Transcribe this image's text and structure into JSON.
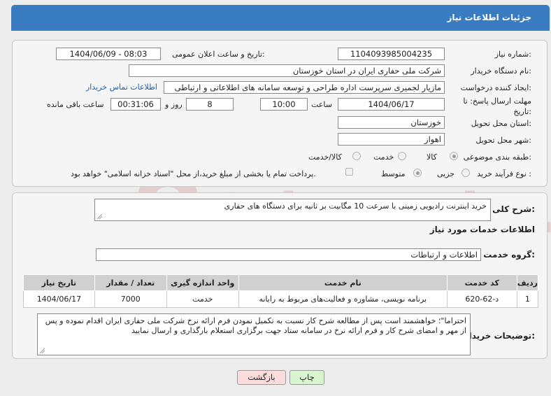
{
  "header": {
    "title": "جزئیات اطلاعات نیاز"
  },
  "form": {
    "need_number_label": "شماره نیاز:",
    "need_number": "1104093985004235",
    "announce_label": "تاریخ و ساعت اعلان عمومی:",
    "announce_value": "1404/06/09 - 08:03",
    "buyer_org_label": "نام دستگاه خریدار:",
    "buyer_org": "شرکت ملی حفاری ایران در استان خوزستان",
    "creator_label": "ایجاد کننده درخواست:",
    "creator": "مازیار لجمیری سرپرست اداره طراحی و توسعه سامانه های اطلاعاتی و ارتباطی",
    "contact_link": "اطلاعات تماس خریدار",
    "deadline_label": "مهلت ارسال پاسخ: تا تاریخ:",
    "deadline_date": "1404/06/17",
    "time_label": "ساعت",
    "deadline_time": "10:00",
    "days_value": "8",
    "days_label": "روز و",
    "remaining_time": "00:31:06",
    "remaining_label": "ساعت باقی مانده",
    "province_label": "استان محل تحویل:",
    "province": "خوزستان",
    "city_label": "شهر محل تحویل:",
    "city": "اهواز",
    "category_label": "طبقه بندی موضوعی:",
    "category_options": [
      "کالا",
      "خدمت",
      "کالا/خدمت"
    ],
    "process_label": "نوع فرآیند خرید :",
    "process_options": [
      "جزیی",
      "متوسط"
    ],
    "payment_note": "پرداخت تمام یا بخشی از مبلغ خرید،از محل \"اسناد خزانه اسلامی\" خواهد بود."
  },
  "detail": {
    "summary_label": "شرح کلی نیاز:",
    "summary": "خرید اینترنت رادیویی زمینی با سرعت 10 مگابیت بر ثانیه برای دستگاه های حفاری",
    "services_title": "اطلاعات خدمات مورد نیاز",
    "service_group_label": "گروه خدمت:",
    "service_group": "اطلاعات و ارتباطات",
    "table": {
      "headers": [
        "ردیف",
        "کد خدمت",
        "نام خدمت",
        "واحد اندازه گیری",
        "تعداد / مقدار",
        "تاریخ نیاز"
      ],
      "rows": [
        [
          "1",
          "د-62-620",
          "برنامه نویسی، مشاوره و فعالیت‌های مربوط به رایانه",
          "خدمت",
          "7000",
          "1404/06/17"
        ]
      ]
    },
    "buyer_notes_label": "توضیحات خریدار:",
    "buyer_notes": "احتراما\"؛ خواهشمند است پس از مطالعه شرح کار نسبت به تکمیل نمودن فرم ارائه نرخ شرکت ملی حفاری ایران اقدام نموده و پس از مهر و امضای شرح کار و فرم ارائه نرخ در سامانه ستاد جهت برگزاری استعلام بارگذاری و ارسال نمایید"
  },
  "buttons": {
    "print": "چاپ",
    "back": "بازگشت"
  },
  "watermark": "AriaTender.neT",
  "colors": {
    "header": "#3a7cc2",
    "print_btn": "#d9f5d0",
    "back_btn": "#fbdcdc"
  }
}
